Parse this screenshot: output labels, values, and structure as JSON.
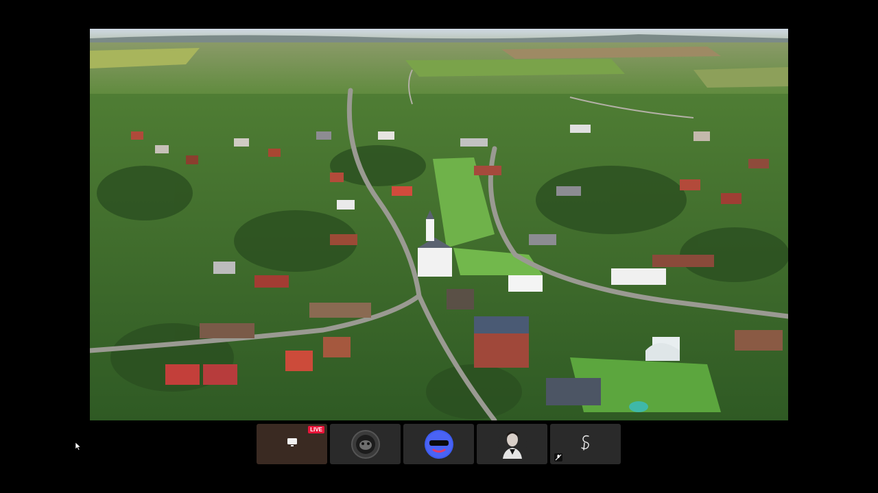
{
  "stage": {
    "content": "aerial-village-video"
  },
  "participants": [
    {
      "name_icon": "screen-share-icon",
      "live_label": "LIVE"
    },
    {
      "name_icon": "avatar-dark-circle"
    },
    {
      "name_icon": "avatar-sunglasses-face"
    },
    {
      "name_icon": "avatar-portrait-photo"
    },
    {
      "name_icon": "avatar-signature-logo",
      "muted": true
    }
  ],
  "colors": {
    "background": "#000000",
    "tile": "#2a2a2a",
    "live": "#e8153a",
    "sunglasses_avatar": "#3d5cf0"
  }
}
